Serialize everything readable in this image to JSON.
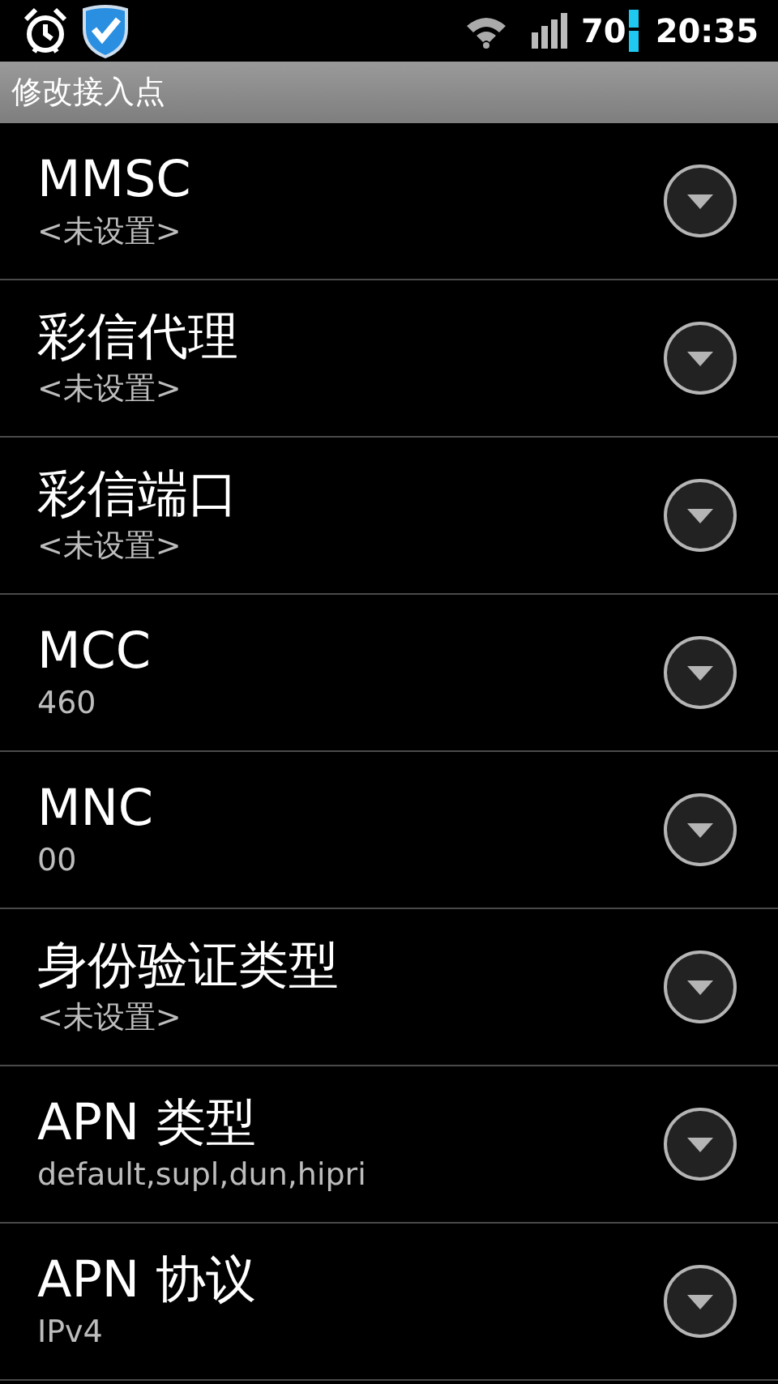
{
  "status_bar": {
    "battery": "70",
    "time": "20:35"
  },
  "title": "修改接入点",
  "settings": [
    {
      "label": "MMSC",
      "value": "<未设置>"
    },
    {
      "label": "彩信代理",
      "value": "<未设置>"
    },
    {
      "label": "彩信端口",
      "value": "<未设置>"
    },
    {
      "label": "MCC",
      "value": "460"
    },
    {
      "label": "MNC",
      "value": "00"
    },
    {
      "label": "身份验证类型",
      "value": "<未设置>"
    },
    {
      "label": "APN 类型",
      "value": "default,supl,dun,hipri"
    },
    {
      "label": "APN 协议",
      "value": "IPv4"
    }
  ]
}
